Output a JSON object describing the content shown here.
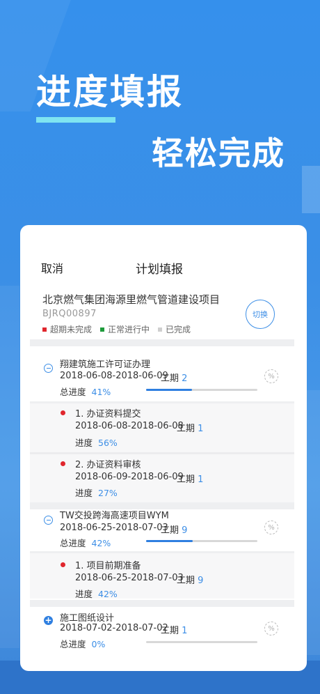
{
  "promo": {
    "headline1": "进度填报",
    "headline2": "轻松完成"
  },
  "header": {
    "cancel_label": "取消",
    "title": "计划填报"
  },
  "project": {
    "name": "北京燃气集团海源里燃气管道建设项目",
    "code": "BJRQ00897",
    "switch_label": "切换",
    "legend": [
      {
        "label": "超期未完成",
        "color": "#e0262d"
      },
      {
        "label": "正常进行中",
        "color": "#1e9b3b"
      },
      {
        "label": "已完成",
        "color": "#cfcfcf"
      }
    ]
  },
  "labels": {
    "period": "工期",
    "total_progress": "总进度",
    "progress": "进度"
  },
  "groups": [
    {
      "title": "翔建筑施工许可证办理",
      "date": "2018-06-08-2018-06-09",
      "period": "2",
      "progress": "41%",
      "progress_value": 0.41,
      "expanded": true,
      "items": [
        {
          "title": "1. 办证资料提交",
          "date": "2018-06-08-2018-06-08",
          "period": "1",
          "progress": "56%"
        },
        {
          "title": "2. 办证资料审核",
          "date": "2018-06-09-2018-06-09",
          "period": "1",
          "progress": "27%"
        }
      ]
    },
    {
      "title": "TW交投跨海高速项目WYM",
      "date": "2018-06-25-2018-07-03",
      "period": "9",
      "progress": "42%",
      "progress_value": 0.42,
      "expanded": true,
      "items": [
        {
          "title": "1. 项目前期准备",
          "date": "2018-06-25-2018-07-03",
          "period": "9",
          "progress": "42%"
        }
      ]
    },
    {
      "title": "施工图纸设计",
      "date": "2018-07-02-2018-07-02",
      "period": "1",
      "progress": "0%",
      "progress_value": 0.0,
      "expanded": false,
      "items": []
    }
  ],
  "icons": {
    "collapse": "minus-circle-icon",
    "expand": "plus-circle-icon",
    "percent": "percent-icon"
  },
  "colors": {
    "accent": "#3c8ee6",
    "overdue": "#e0262d",
    "normal": "#1e9b3b",
    "done": "#cfcfcf"
  }
}
